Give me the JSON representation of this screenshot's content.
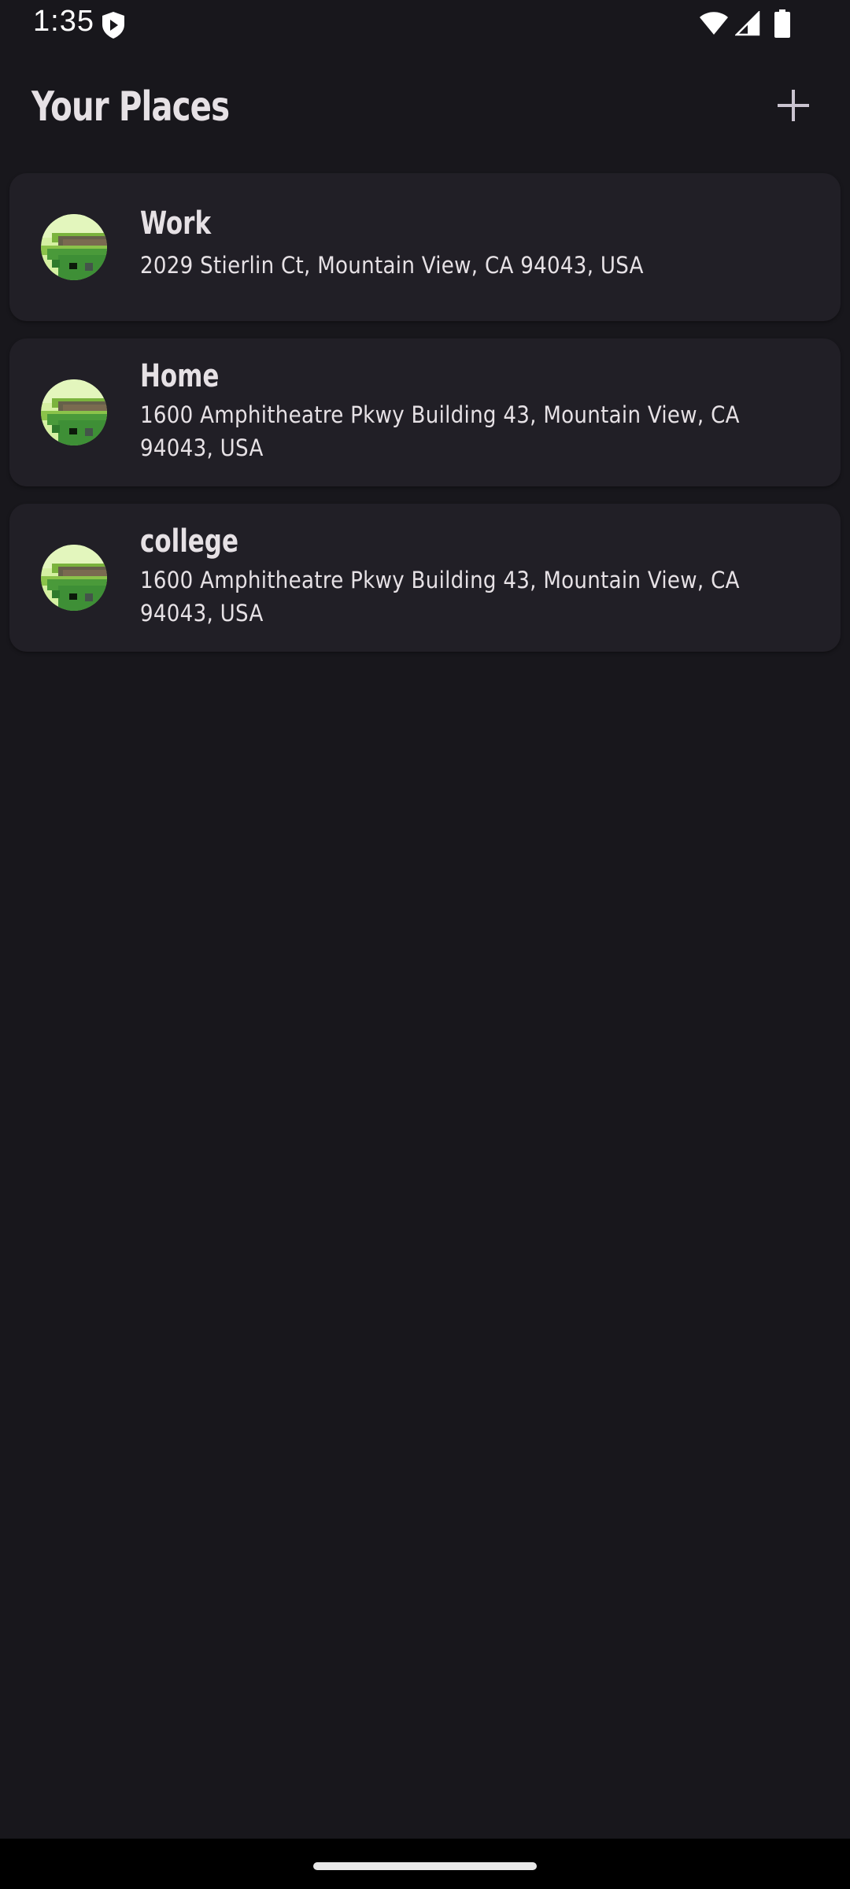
{
  "status_bar": {
    "time": "1:35",
    "icons": [
      "shield-play-icon",
      "wifi-icon",
      "signal-icon",
      "battery-icon"
    ]
  },
  "header": {
    "title": "Your Places",
    "add_icon": "plus-icon"
  },
  "places": [
    {
      "name": "Work",
      "address": "2029 Stierlin Ct, Mountain View, CA 94043, USA",
      "icon": "map-thumbnail"
    },
    {
      "name": "Home",
      "address": "1600 Amphitheatre Pkwy Building 43, Mountain View, CA 94043, USA",
      "icon": "map-thumbnail"
    },
    {
      "name": "college",
      "address": "1600 Amphitheatre Pkwy Building 43, Mountain View, CA 94043, USA",
      "icon": "map-thumbnail"
    }
  ],
  "colors": {
    "background": "#18171c",
    "card": "#211f26",
    "text": "#e6e1e5",
    "nav_bar": "#000000"
  }
}
